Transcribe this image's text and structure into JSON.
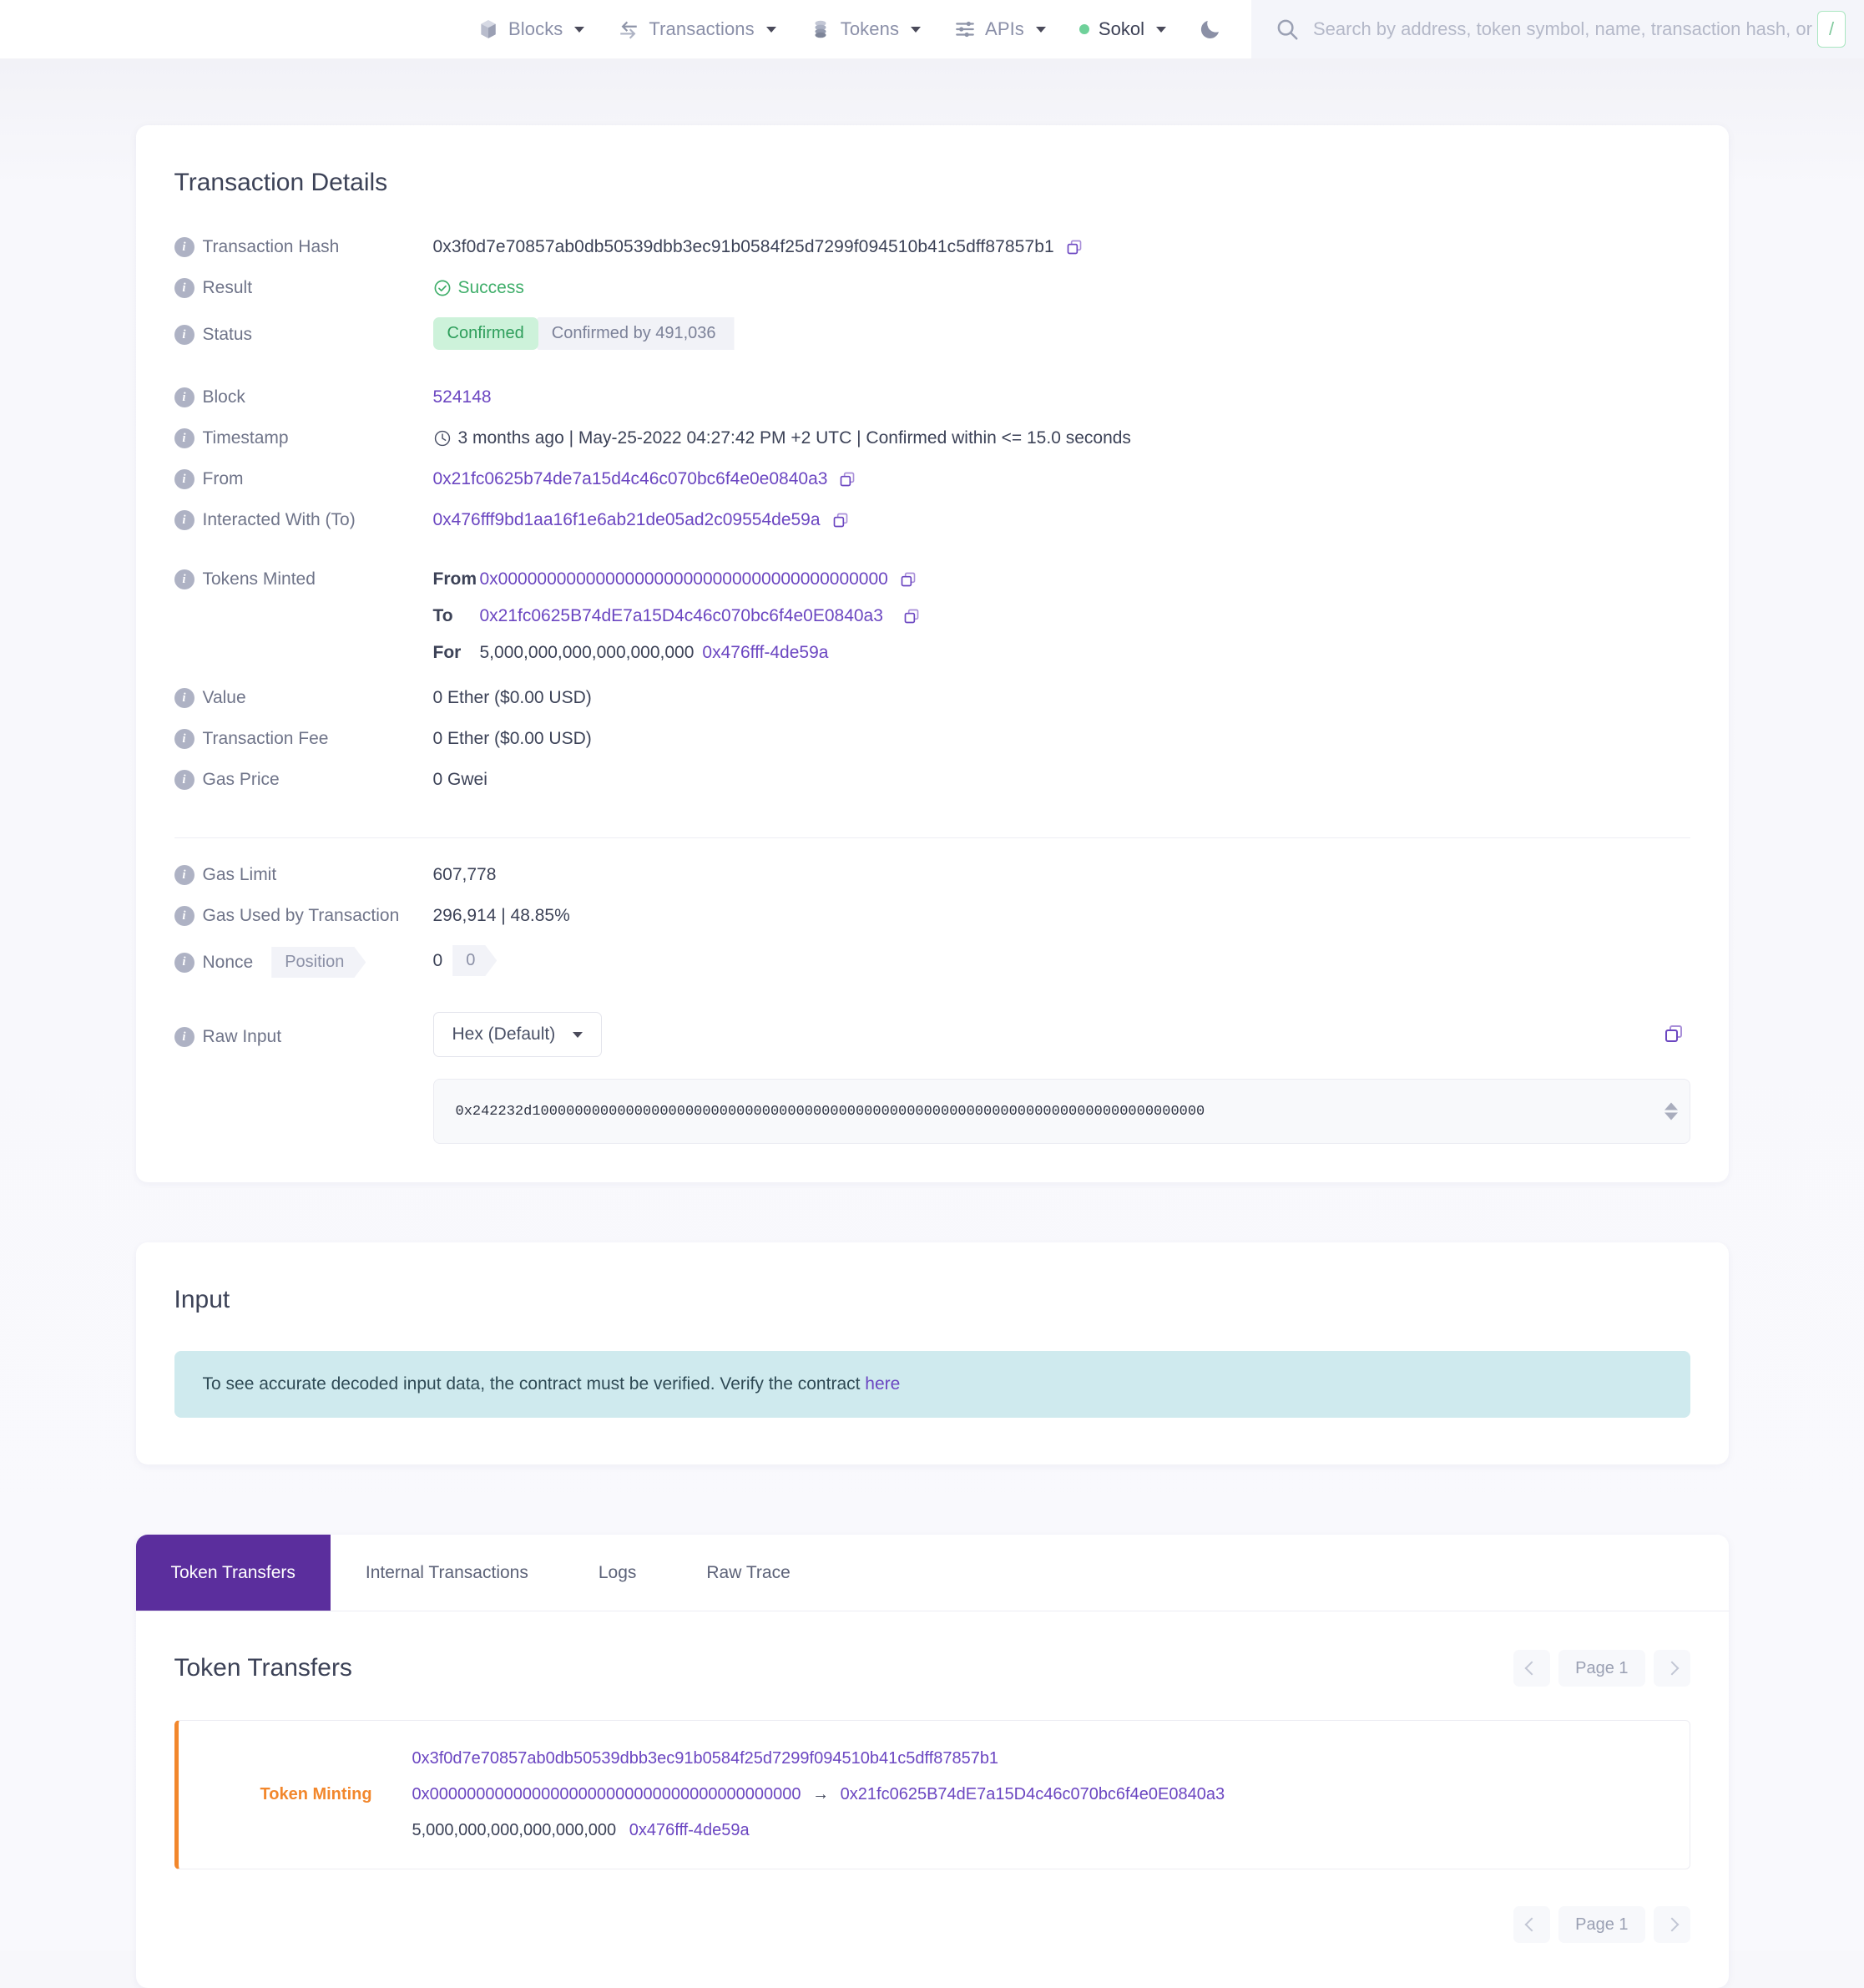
{
  "header": {
    "nav": [
      {
        "label": "Blocks",
        "icon": "cube-icon",
        "has_caret": true
      },
      {
        "label": "Transactions",
        "icon": "transactions-arrows-icon",
        "has_caret": true
      },
      {
        "label": "Tokens",
        "icon": "coins-stack-icon",
        "has_caret": true
      },
      {
        "label": "APIs",
        "icon": "sliders-icon",
        "has_caret": true
      }
    ],
    "network": {
      "label": "Sokol",
      "dot_color": "#6fd19a"
    },
    "theme_toggle": "moon-icon",
    "search": {
      "placeholder": "Search by address, token symbol, name, transaction hash, or block number",
      "value": "",
      "shortcut_key": "/"
    }
  },
  "details": {
    "title": "Transaction Details",
    "labels": {
      "tx_hash": "Transaction Hash",
      "result": "Result",
      "status": "Status",
      "block": "Block",
      "timestamp": "Timestamp",
      "from": "From",
      "to": "Interacted With (To)",
      "tokens_minted": "Tokens Minted",
      "value": "Value",
      "tx_fee": "Transaction Fee",
      "gas_price": "Gas Price",
      "gas_limit": "Gas Limit",
      "gas_used": "Gas Used by Transaction",
      "nonce": "Nonce",
      "position": "Position",
      "raw_input": "Raw Input"
    },
    "values": {
      "tx_hash": "0x3f0d7e70857ab0db50539dbb3ec91b0584f25d7299f094510b41c5dff87857b1",
      "result": "Success",
      "status_confirmed": "Confirmed",
      "status_by": "Confirmed by 491,036",
      "block": "524148",
      "timestamp": "3 months ago | May-25-2022 04:27:42 PM +2 UTC | Confirmed within <= 15.0 seconds",
      "from": "0x21fc0625b74de7a15d4c46c070bc6f4e0e0840a3",
      "to": "0x476fff9bd1aa16f1e6ab21de05ad2c09554de59a",
      "minted_from_key": "From",
      "minted_from": "0x0000000000000000000000000000000000000000",
      "minted_to_key": "To",
      "minted_to": "0x21fc0625B74dE7a15D4c46c070bc6f4e0E0840a3",
      "minted_for_key": "For",
      "minted_amount": "5,000,000,000,000,000,000",
      "minted_token": "0x476fff-4de59a",
      "value": "0 Ether ($0.00 USD)",
      "tx_fee": "0 Ether ($0.00 USD)",
      "gas_price": "0 Gwei",
      "gas_limit": "607,778",
      "gas_used": "296,914 | 48.85%",
      "nonce_value": "0",
      "position_value": "0",
      "raw_input_format": "Hex (Default)",
      "raw_input_hex": "0x242232d1000000000000000000000000000000000000000000000000000000000000000000000000000000"
    }
  },
  "input_section": {
    "title": "Input",
    "notice_text": "To see accurate decoded input data, the contract must be verified. Verify the contract ",
    "notice_link": "here"
  },
  "tabs": {
    "items": [
      {
        "label": "Token Transfers",
        "active": true
      },
      {
        "label": "Internal Transactions",
        "active": false
      },
      {
        "label": "Logs",
        "active": false
      },
      {
        "label": "Raw Trace",
        "active": false
      }
    ]
  },
  "transfers": {
    "title": "Token Transfers",
    "pager": {
      "prev": "‹",
      "page": "Page 1",
      "next": "›"
    },
    "rows": [
      {
        "type": "Token Minting",
        "tx_hash": "0x3f0d7e70857ab0db50539dbb3ec91b0584f25d7299f094510b41c5dff87857b1",
        "from": "0x0000000000000000000000000000000000000000",
        "arrow": "→",
        "to": "0x21fc0625B74dE7a15D4c46c070bc6f4e0E0840a3",
        "amount": "5,000,000,000,000,000,000",
        "token": "0x476fff-4de59a"
      }
    ]
  },
  "colors": {
    "accent_purple": "#6b46c1",
    "tab_active": "#5b2e9d",
    "success_green": "#3fae6a",
    "pill_green_bg": "#cdf2da",
    "orange": "#f2872c",
    "notice_bg": "#cfeaee"
  }
}
